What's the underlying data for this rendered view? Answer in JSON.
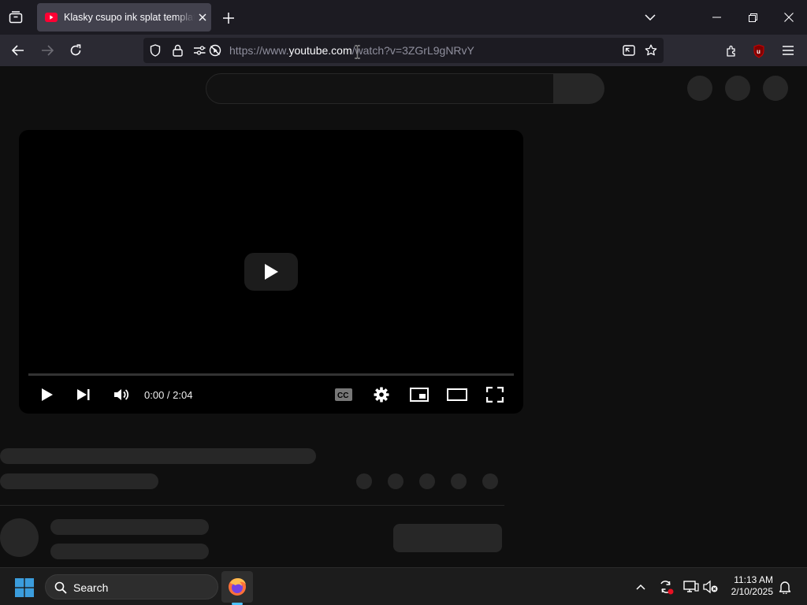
{
  "browser": {
    "tab": {
      "title": "Klasky csupo ink splat template"
    },
    "url": {
      "prefix": "https://www.",
      "host": "youtube.com",
      "path": "/watch?v=3ZGrL9gNRvY"
    },
    "extension_badge": "1"
  },
  "player": {
    "time_display": "0:00 / 2:04",
    "progress": 0
  },
  "taskbar": {
    "search_label": "Search",
    "time": "11:13 AM",
    "date": "2/10/2025"
  },
  "colors": {
    "youtube_red": "#ff0033",
    "firefox_orange": "#ff7139",
    "windows_blue": "#3b9ddd"
  }
}
